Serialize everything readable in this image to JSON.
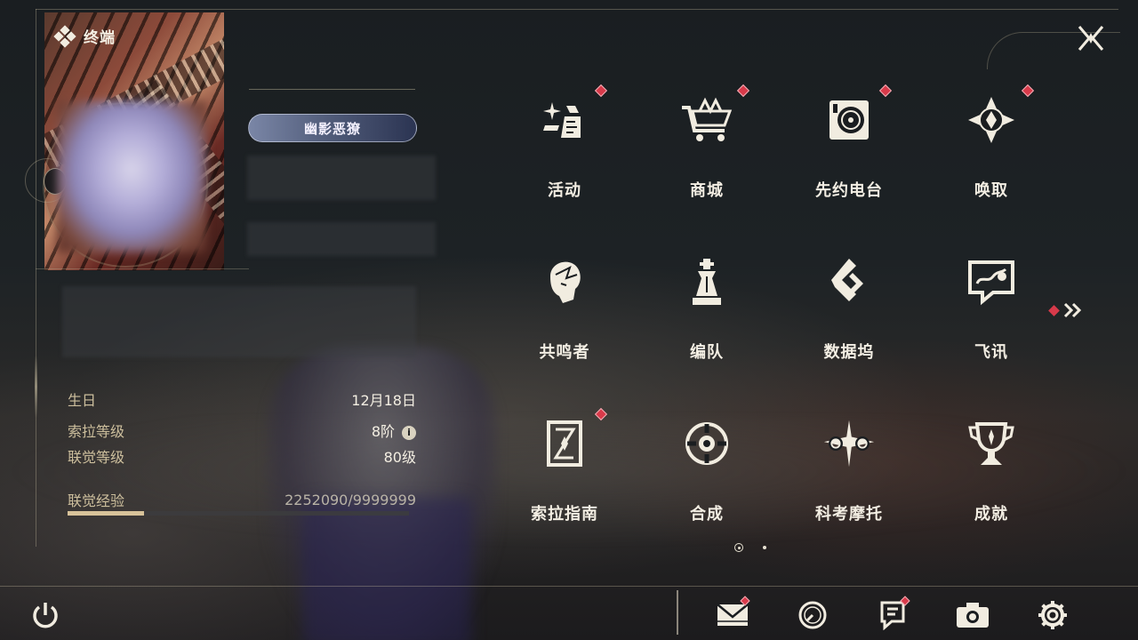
{
  "window": {
    "title": "终端"
  },
  "profile": {
    "title_badge": "幽影恶獠",
    "birthday_label": "生日",
    "birthday_value": "12月18日",
    "sola_level_label": "索拉等级",
    "sola_level_value": "8阶",
    "union_level_label": "联觉等级",
    "union_level_value": "80级",
    "union_exp_label": "联觉经验",
    "union_exp_value": "2252090/9999999",
    "union_exp_progress": 0.2252
  },
  "menu": {
    "items": [
      {
        "label": "活动",
        "icon": "event-sparkle-icon",
        "notify": true
      },
      {
        "label": "商城",
        "icon": "shop-cart-icon",
        "notify": true
      },
      {
        "label": "先约电台",
        "icon": "radio-icon",
        "notify": true
      },
      {
        "label": "唤取",
        "icon": "convene-compass-icon",
        "notify": true
      },
      {
        "label": "共鸣者",
        "icon": "resonator-portrait-icon",
        "notify": false
      },
      {
        "label": "编队",
        "icon": "team-chess-icon",
        "notify": false
      },
      {
        "label": "数据坞",
        "icon": "data-bank-icon",
        "notify": false
      },
      {
        "label": "飞讯",
        "icon": "message-bubble-icon",
        "notify": false
      },
      {
        "label": "索拉指南",
        "icon": "guidebook-icon",
        "notify": true
      },
      {
        "label": "合成",
        "icon": "synthesis-icon",
        "notify": false
      },
      {
        "label": "科考摩托",
        "icon": "motorcycle-icon",
        "notify": false
      },
      {
        "label": "成就",
        "icon": "trophy-icon",
        "notify": false
      }
    ],
    "page_current": 1,
    "page_count": 2
  },
  "info_icon": "i",
  "bottom_bar": {
    "buttons": [
      {
        "icon": "mail-icon",
        "notify": true
      },
      {
        "icon": "clock-icon",
        "notify": false
      },
      {
        "icon": "notice-icon",
        "notify": true
      },
      {
        "icon": "camera-icon",
        "notify": false
      },
      {
        "icon": "gear-icon",
        "notify": false
      }
    ]
  },
  "colors": {
    "accent": "#d8c39a",
    "notify": "#d83a4a",
    "text": "#f3eee3",
    "label": "#cdbf9d"
  }
}
